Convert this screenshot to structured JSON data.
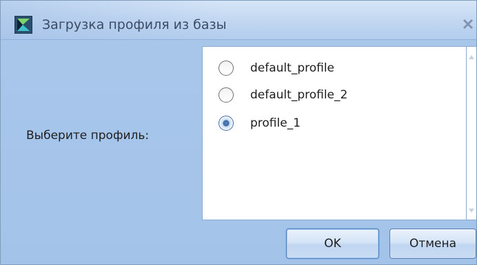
{
  "window": {
    "title": "Загрузка профиля из базы",
    "icon": "app-flag-icon",
    "close_icon": "close-icon"
  },
  "form": {
    "prompt_label": "Выберите профиль:"
  },
  "profiles": {
    "items": [
      {
        "label": "default_profile",
        "checked": false
      },
      {
        "label": "default_profile_2",
        "checked": false
      },
      {
        "label": "profile_1",
        "checked": true
      }
    ],
    "selected": "profile_1"
  },
  "buttons": {
    "ok_label": "OK",
    "cancel_label": "Отмена"
  },
  "colors": {
    "window_bg": "#a9c7ea",
    "titlebar": "#c4d9f2",
    "title_text": "#3b4b63",
    "border": "#8daad0"
  }
}
